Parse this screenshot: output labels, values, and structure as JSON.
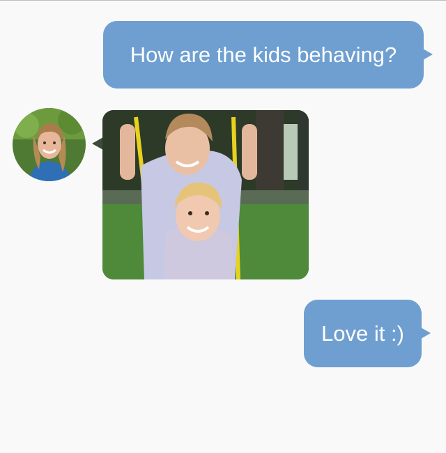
{
  "conversation": {
    "messages": [
      {
        "sender": "me",
        "type": "text",
        "text": "How are the kids behaving?"
      },
      {
        "sender": "contact",
        "type": "image",
        "image": "photo-of-two-girls-on-swing"
      },
      {
        "sender": "me",
        "type": "text",
        "text": "Love it :)"
      }
    ],
    "contact": {
      "avatar": "woman-smiling-avatar"
    }
  },
  "colors": {
    "background": "#f9f9f9",
    "outgoing_bubble": "#6f9fd0",
    "bubble_text": "#ffffff"
  }
}
